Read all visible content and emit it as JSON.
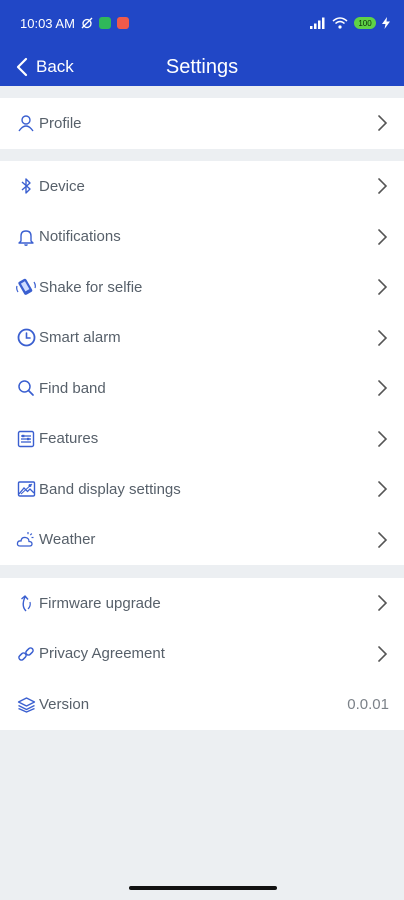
{
  "status_bar": {
    "time": "10:03 AM",
    "battery": "100"
  },
  "nav": {
    "back_label": "Back",
    "title": "Settings"
  },
  "sections": [
    {
      "items": [
        {
          "label": "Profile",
          "icon": "person-icon"
        }
      ]
    },
    {
      "items": [
        {
          "label": "Device",
          "icon": "bluetooth-icon"
        },
        {
          "label": "Notifications",
          "icon": "bell-icon"
        },
        {
          "label": "Shake for selfie",
          "icon": "shake-phone-icon"
        },
        {
          "label": "Smart alarm",
          "icon": "clock-icon"
        },
        {
          "label": "Find band",
          "icon": "search-icon"
        },
        {
          "label": "Features",
          "icon": "features-list-icon"
        },
        {
          "label": "Band display settings",
          "icon": "display-image-icon"
        },
        {
          "label": "Weather",
          "icon": "cloud-sun-icon"
        }
      ]
    },
    {
      "items": [
        {
          "label": "Firmware upgrade",
          "icon": "upgrade-arrow-icon"
        },
        {
          "label": "Privacy Agreement",
          "icon": "link-icon"
        },
        {
          "label": "Version",
          "icon": "version-stack-icon",
          "value": "0.0.01"
        }
      ]
    }
  ],
  "colors": {
    "header": "#2147c6",
    "icon_blue": "#3a5fd0",
    "text": "#57606a",
    "background": "#eceff2"
  }
}
